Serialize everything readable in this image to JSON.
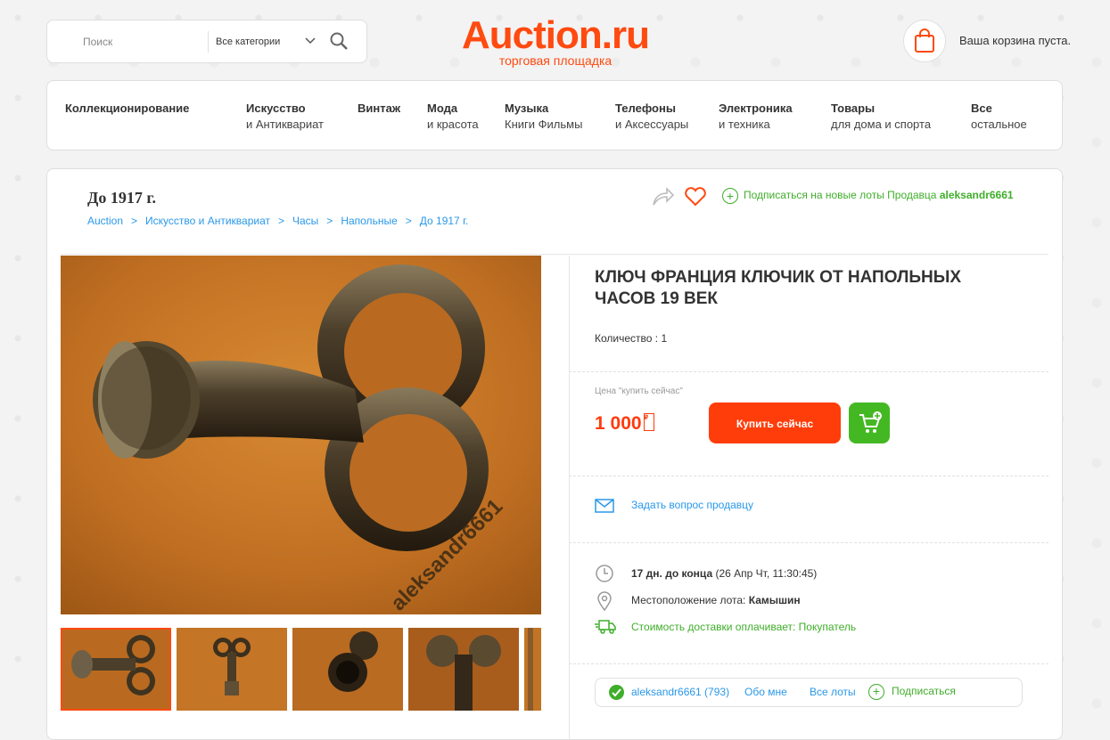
{
  "header": {
    "search_placeholder": "Поиск",
    "category_select": "Все категории",
    "logo_name": "Auction.ru",
    "logo_sub": "торговая площадка",
    "cart_text": "Ваша корзина пуста.",
    "brand_color": "#ff4a10"
  },
  "nav": [
    {
      "top": "Коллекционирование",
      "bottom": ""
    },
    {
      "top": "Искусство",
      "bottom": "и Антиквариат"
    },
    {
      "top": "Винтаж",
      "bottom": ""
    },
    {
      "top": "Мода",
      "bottom": "и красота"
    },
    {
      "top": "Музыка",
      "bottom": "Книги Фильмы"
    },
    {
      "top": "Телефоны",
      "bottom": "и Аксессуары"
    },
    {
      "top": "Электроника",
      "bottom": "и техника"
    },
    {
      "top": "Товары",
      "bottom": "для дома и спорта"
    },
    {
      "top": "Все",
      "bottom": "остальное"
    }
  ],
  "page": {
    "title": "До 1917 г.",
    "breadcrumbs": [
      "Auction",
      "Искусство и Антиквариат",
      "Часы",
      "Напольные",
      "До 1917 г."
    ],
    "breadcrumb_sep": ">",
    "subscribe_text": "Подписаться на новые лоты Продавца",
    "seller_name": "aleksandr6661"
  },
  "lot": {
    "title": "КЛЮЧ ФРАНЦИЯ КЛЮЧИК ОТ НАПОЛЬНЫХ ЧАСОВ 19 ВЕК",
    "quantity_label": "Количество : 1",
    "price_label": "Цена \"купить сейчас\"",
    "price": "1 000",
    "currency_symbol": "₽",
    "buy_button": "Купить сейчас",
    "ask_seller": "Задать вопрос продавцу",
    "time_left": "17 дн. до конца",
    "end_date": "(26 Апр Чт, 11:30:45)",
    "location_label": "Местоположение лота:",
    "location": "Камышин",
    "shipping": "Стоимость доставки оплачивает: Покупатель",
    "watermark": "aleksandr6661"
  },
  "seller": {
    "name": "aleksandr6661 (793)",
    "about": "Обо мне",
    "all_lots": "Все лоты",
    "subscribe": "Подписаться"
  }
}
